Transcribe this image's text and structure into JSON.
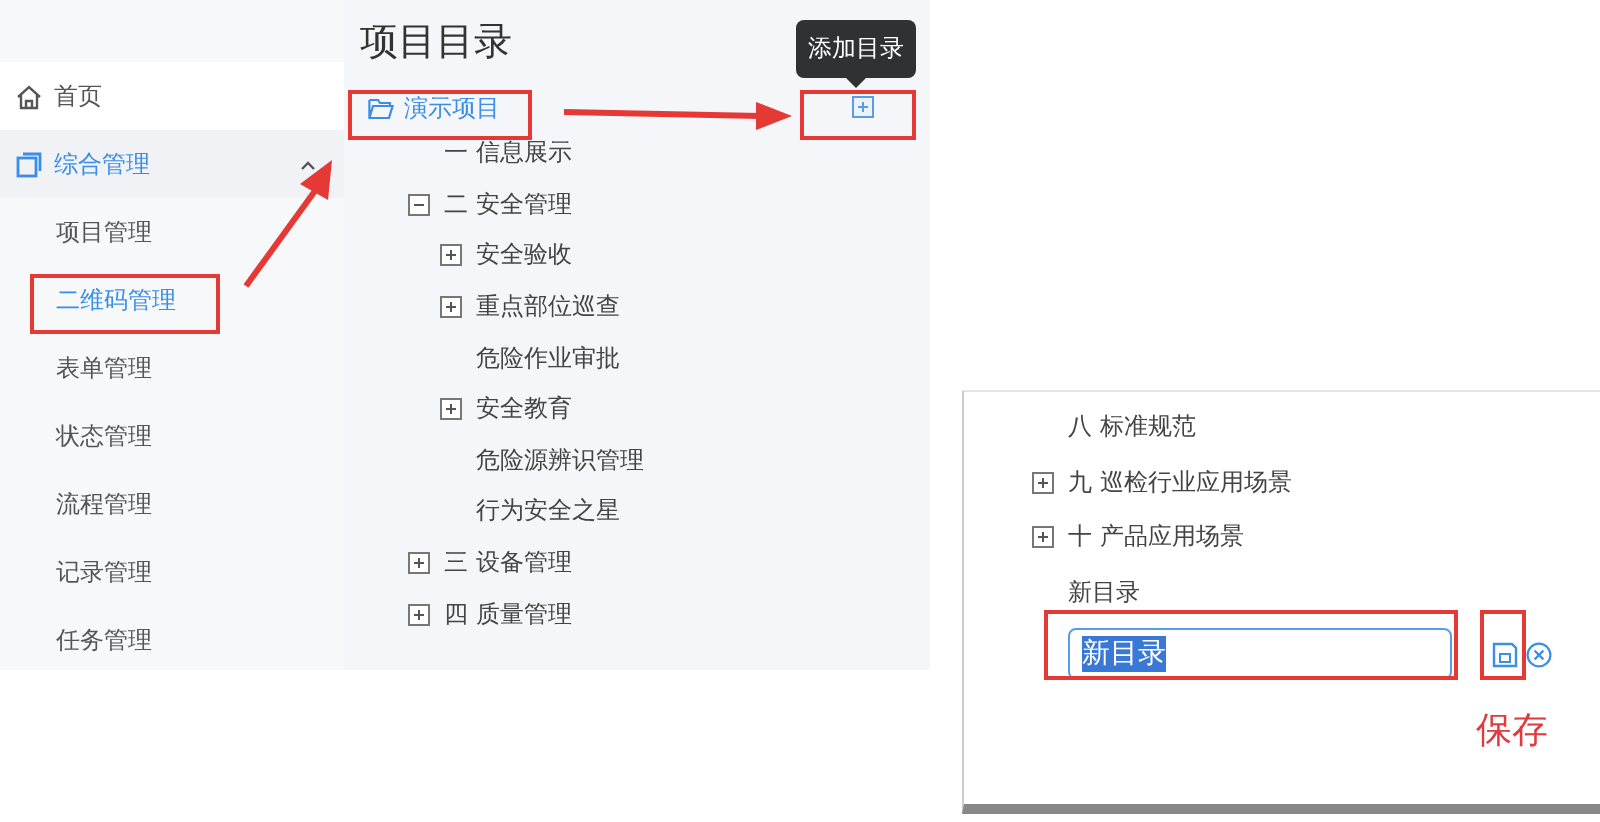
{
  "sidebar": {
    "items": [
      {
        "label": "首页",
        "kind": "home",
        "selected": false
      },
      {
        "label": "综合管理",
        "kind": "group",
        "expanded": true,
        "children": [
          {
            "label": "项目管理",
            "selected": false
          },
          {
            "label": "二维码管理",
            "selected": true
          },
          {
            "label": "表单管理",
            "selected": false
          },
          {
            "label": "状态管理",
            "selected": false
          },
          {
            "label": "流程管理",
            "selected": false
          },
          {
            "label": "记录管理",
            "selected": false
          },
          {
            "label": "任务管理",
            "selected": false
          }
        ]
      }
    ]
  },
  "tree": {
    "title": "项目目录",
    "root": {
      "label": "演示项目",
      "selected": true
    },
    "tooltip": "添加目录",
    "nodes": [
      {
        "label": "一 信息展示"
      },
      {
        "label": "二 安全管理",
        "expanded": true,
        "children": [
          {
            "label": "安全验收",
            "expanded": false
          },
          {
            "label": "重点部位巡查",
            "expanded": false
          },
          {
            "label": "危险作业审批"
          },
          {
            "label": "安全教育",
            "expanded": false
          },
          {
            "label": "危险源辨识管理"
          },
          {
            "label": "行为安全之星"
          }
        ]
      },
      {
        "label": "三 设备管理",
        "expanded": false
      },
      {
        "label": "四 质量管理",
        "expanded": false
      }
    ]
  },
  "tree_detail": {
    "nodes": [
      {
        "label": "八 标准规范"
      },
      {
        "label": "九 巡检行业应用场景",
        "expanded": false
      },
      {
        "label": "十 产品应用场景",
        "expanded": false
      },
      {
        "label": "新目录"
      }
    ],
    "editor": {
      "value": "新目录",
      "text_selected": true
    }
  },
  "annotation": {
    "label": "保存"
  }
}
